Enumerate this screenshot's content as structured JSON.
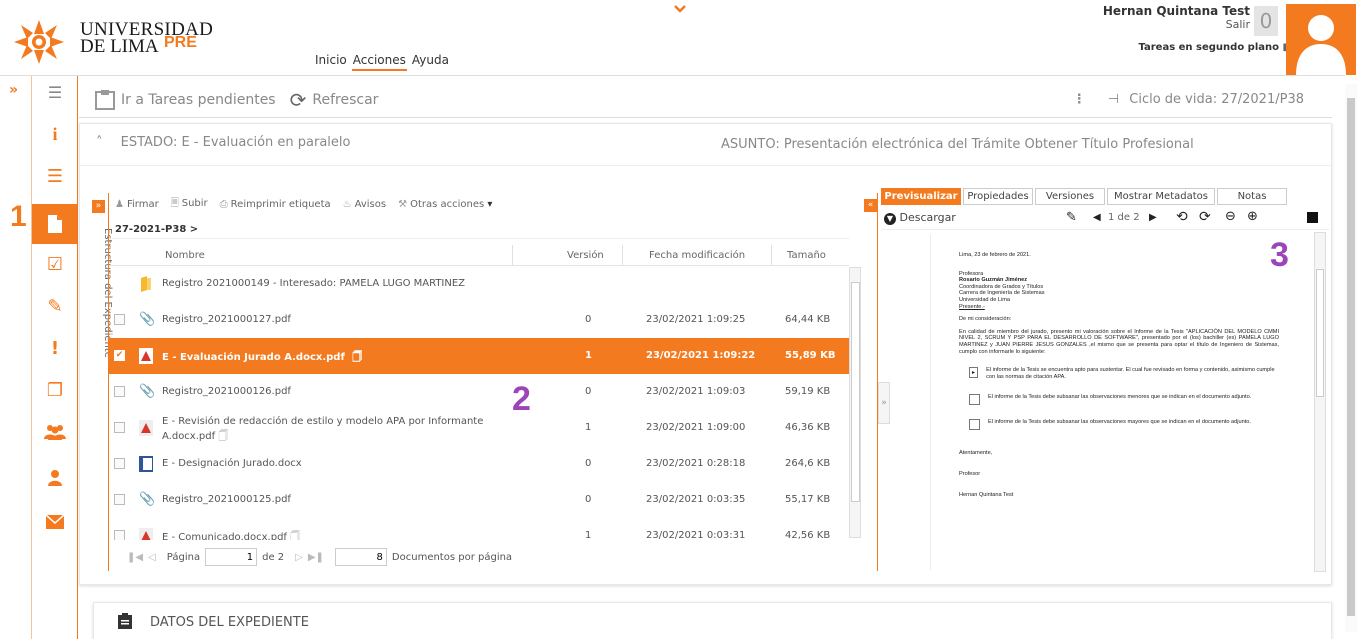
{
  "header": {
    "logo_line1": "UNIVERSIDAD",
    "logo_line2": "DE LIMA",
    "logo_pre": "PRE",
    "nav": [
      "Inicio",
      "Acciones",
      "Ayuda"
    ],
    "user_name": "Hernan Quintana Test",
    "logout": "Salir",
    "task_count": "0",
    "background_tasks": "Tareas en segundo plano"
  },
  "toolbar": {
    "pending": "Ir a Tareas pendientes",
    "refresh": "Refrescar",
    "lifecycle": "Ciclo de vida: 27/2021/P38"
  },
  "estado": "ESTADO: E - Evaluación en paralelo",
  "asunto": "ASUNTO: Presentación electrónica del Trámite Obtener Título Profesional",
  "markers": [
    "1",
    "2",
    "3"
  ],
  "docs": {
    "side_label": "Estructura del Expediente",
    "actions": [
      "Firmar",
      "Subir",
      "Reimprimir etiqueta",
      "Avisos",
      "Otras acciones"
    ],
    "breadcrumb": "27-2021-P38 >",
    "columns": [
      "Nombre",
      "Versión",
      "Fecha modificación",
      "Tamaño"
    ],
    "rows": [
      {
        "name": "Registro 2021000149 - Interesado: PAMELA LUGO MARTINEZ",
        "version": "",
        "date": "",
        "size": "",
        "type": "folder"
      },
      {
        "name": "Registro_2021000127.pdf",
        "version": "0",
        "date": "23/02/2021 1:09:25",
        "size": "64,44 KB",
        "type": "clip"
      },
      {
        "name": "E - Evaluación Jurado A.docx.pdf",
        "version": "1",
        "date": "23/02/2021 1:09:22",
        "size": "55,89 KB",
        "type": "pdf",
        "selected": true
      },
      {
        "name": "Registro_2021000126.pdf",
        "version": "0",
        "date": "23/02/2021 1:09:03",
        "size": "59,19 KB",
        "type": "clip"
      },
      {
        "name": "E - Revisión de redacción de estilo y modelo APA por Informante",
        "name2": "A.docx.pdf",
        "version": "1",
        "date": "23/02/2021 1:09:00",
        "size": "46,36 KB",
        "type": "pdf"
      },
      {
        "name": "E - Designación Jurado.docx",
        "version": "0",
        "date": "23/02/2021 0:28:18",
        "size": "264,6 KB",
        "type": "word"
      },
      {
        "name": "Registro_2021000125.pdf",
        "version": "0",
        "date": "23/02/2021 0:03:35",
        "size": "55,17 KB",
        "type": "clip"
      },
      {
        "name": "E - Comunicado.docx.pdf",
        "version": "1",
        "date": "23/02/2021 0:03:31",
        "size": "42,56 KB",
        "type": "pdf"
      }
    ],
    "pager": {
      "label": "Página",
      "page": "1",
      "of": "de 2",
      "per_page": "8",
      "per_page_label": "Documentos por página"
    }
  },
  "preview": {
    "tabs": [
      "Previsualizar",
      "Propiedades",
      "Versiones",
      "Mostrar Metadatos",
      "Notas"
    ],
    "download": "Descargar",
    "page_indicator": "1 de 2",
    "letter": {
      "date": "Lima, 23 de febrero de 2021.",
      "to": [
        "Profesora",
        "Rosario Guzmán Jiménez",
        "Coordinadora de Grados y Títulos",
        "Carrera de Ingeniería de Sistemas",
        "Universidad de Lima",
        "Presente.-"
      ],
      "greeting": "De mi consideración:",
      "body": "En calidad de miembro del jurado, presento mi valoración sobre el Informe de la Tesis \"APLICACIÓN DEL MODELO CMMI NIVEL 2, SCRUM Y PSP PARA EL DESARROLLO DE SOFTWARE\", presentado por el (los) bachiller (es) PAMELA LUGO MARTINEZ y JUAN PIERRE JESUS GONZALES ,el mismo que se presenta para optar el título de Ingeniero de Sistemas, cumplo con informarle lo siguiente:",
      "options": [
        "El informe de la Tesis se encuentra apto para sustentar. El cual fue revisado en forma y contenido, asimismo cumple con las normas de citación APA.",
        "El informe de la Tesis debe subsanar las observaciones menores que se indican en el documento adjunto.",
        "El informe de la Tesis debe subsanar las observaciones mayores que se indican en el documento adjunto."
      ],
      "closing": "Atentamente,",
      "role": "Profesor",
      "signer": "Hernan Quintana Test"
    }
  },
  "datos_title": "DATOS DEL EXPEDIENTE",
  "colors": {
    "accent": "#f47a20",
    "marker": "#9b45b8"
  }
}
